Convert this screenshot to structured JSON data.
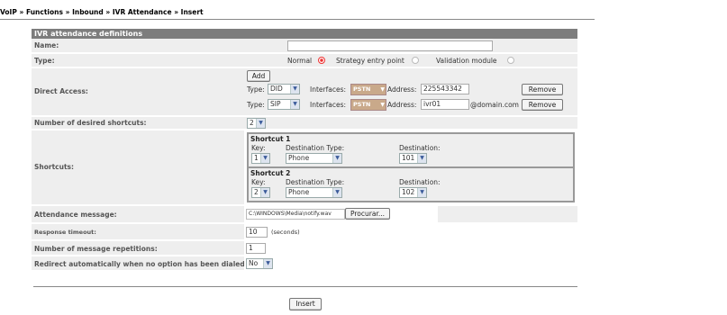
{
  "breadcrumb": {
    "items": [
      "VoIP",
      "Functions",
      "Inbound",
      "IVR Attendance",
      "Insert"
    ],
    "separator": "»"
  },
  "form": {
    "header": "IVR attendance definitions",
    "name": {
      "label": "Name:",
      "value": ""
    },
    "type": {
      "label": "Type:",
      "options": [
        {
          "label": "Normal",
          "selected": true
        },
        {
          "label": "Strategy entry point",
          "selected": false
        },
        {
          "label": "Validation module",
          "selected": false
        }
      ]
    },
    "direct_access": {
      "label": "Direct Access:",
      "add_label": "Add",
      "type_label": "Type:",
      "interfaces_label": "Interfaces:",
      "address_label": "Address:",
      "remove_label": "Remove",
      "entries": [
        {
          "type": "DID",
          "interface": "PSTN",
          "address": "225543342",
          "suffix": ""
        },
        {
          "type": "SIP",
          "interface": "PSTN",
          "address": "ivr01",
          "suffix": "@domain.com"
        }
      ]
    },
    "num_shortcuts": {
      "label": "Number of desired shortcuts:",
      "value": "2"
    },
    "shortcuts": {
      "label": "Shortcuts:",
      "key_label": "Key:",
      "dest_type_label": "Destination Type:",
      "dest_label": "Destination:",
      "items": [
        {
          "title": "Shortcut 1",
          "key": "1",
          "dest_type": "Phone",
          "dest": "101"
        },
        {
          "title": "Shortcut 2",
          "key": "2",
          "dest_type": "Phone",
          "dest": "102"
        }
      ]
    },
    "attendance_message": {
      "label": "Attendance message:",
      "value": "C:\\WINDOWS\\Media\\notify.wav",
      "browse_label": "Procurar..."
    },
    "response_timeout": {
      "label": "Response timeout:",
      "value": "10",
      "unit": "(seconds)"
    },
    "repetitions": {
      "label": "Number of message repetitions:",
      "value": "1"
    },
    "redirect": {
      "label": "Redirect automatically when no option has been dialed:",
      "value": "No"
    }
  },
  "insert_label": "Insert",
  "colors": {
    "header_bg": "#7d7d7d",
    "row_bg": "#eeeeee",
    "radio_selected": "#ee3333",
    "pstn_bg": "#c9a98a"
  }
}
